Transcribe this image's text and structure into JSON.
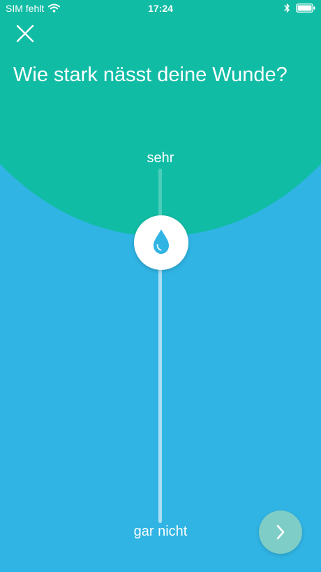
{
  "status_bar": {
    "carrier": "SIM fehlt",
    "time": "17:24"
  },
  "question": {
    "title": "Wie stark nässt deine Wunde?"
  },
  "scale": {
    "max_label": "sehr",
    "min_label": "gar nicht",
    "level": 0.79
  },
  "icons": {
    "close": "close-icon",
    "thumb": "water-drop-icon",
    "next": "chevron-right-icon",
    "wifi": "wifi-icon",
    "bluetooth": "bluetooth-icon",
    "battery": "battery-icon"
  },
  "colors": {
    "top_background": "#11bca5",
    "bottom_background": "#30b4e4",
    "drop": "#30b4e4",
    "next_button": "#7ecdc6",
    "text": "#ffffff"
  }
}
